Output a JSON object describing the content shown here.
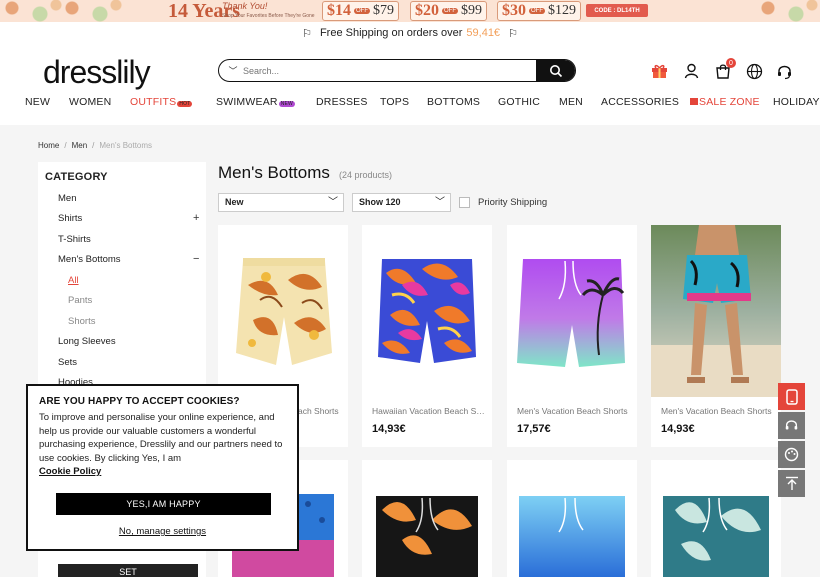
{
  "promo": {
    "years": "14 Years",
    "thanks": "Thank You!",
    "thanks_sub": "Shop Your Favorites Before They're Gone",
    "deals": [
      {
        "big": "$14",
        "off": "OFF",
        "min": "$79"
      },
      {
        "big": "$20",
        "off": "OFF",
        "min": "$99"
      },
      {
        "big": "$30",
        "off": "OFF",
        "min": "$129"
      }
    ],
    "code": "CODE : DL14TH"
  },
  "shipping": {
    "text": "Free Shipping on orders over",
    "amount": "59,41€"
  },
  "header": {
    "logo": "dresslily",
    "search_placeholder": "Search...",
    "cart_count": "0",
    "icons": [
      "gift-icon",
      "user-icon",
      "cart-icon",
      "globe-icon",
      "headset-icon"
    ]
  },
  "nav": {
    "items": [
      "NEW",
      "WOMEN",
      "OUTFITS",
      "SWIMWEAR",
      "DRESSES",
      "TOPS",
      "BOTTOMS",
      "GOTHIC",
      "MEN",
      "ACCESSORIES",
      "SALE ZONE",
      "HOLIDAYS"
    ],
    "outfits_tag": "HOT",
    "swimwear_tag": "NEW"
  },
  "breadcrumb": {
    "home": "Home",
    "men": "Men",
    "current": "Men's Bottoms"
  },
  "sidebar": {
    "heading": "CATEGORY",
    "items": [
      "Men",
      "Shirts",
      "T-Shirts",
      "Men's Bottoms",
      "All",
      "Pants",
      "Shorts",
      "Long Sleeves",
      "Sets",
      "Hoodies"
    ],
    "plus": "+",
    "minus": "−",
    "set_button": "SET"
  },
  "listing": {
    "title": "Men's Bottoms",
    "count": "(24 products)",
    "sort_value": "New",
    "show_value": "Show 120",
    "priority_label": "Priority Shipping"
  },
  "products": [
    {
      "name": "Men's Vacation Beach Shorts",
      "price": ""
    },
    {
      "name": "Hawaiian Vacation Beach Shorts",
      "price": "14,93€"
    },
    {
      "name": "Men's Vacation Beach Shorts",
      "price": "17,57€"
    },
    {
      "name": "Men's Vacation Beach Shorts",
      "price": "14,93€"
    }
  ],
  "cookie": {
    "title": "ARE YOU HAPPY TO ACCEPT COOKIES?",
    "body": "To improve and personalise your online experience, and help us provide our valuable customers a wonderful purchasing experience, Dresslily and our partners need to use cookies. By clicking Yes, I am",
    "policy": "Cookie Policy",
    "accept": "YES,I AM HAPPY",
    "manage": "No, manage settings"
  },
  "colors": {
    "accent": "#e4453a",
    "amount": "#f3a05b",
    "dark": "#111111"
  }
}
